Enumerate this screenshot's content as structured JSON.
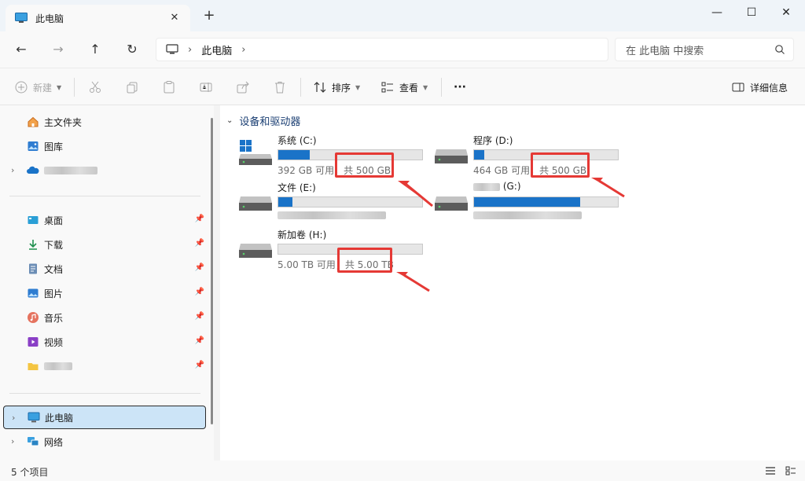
{
  "window": {
    "tab_title": "此电脑",
    "tab_close": "✕",
    "new_tab": "+",
    "minimize": "—",
    "maximize": "☐",
    "close": "✕"
  },
  "nav": {
    "back": "←",
    "forward": "→",
    "up": "↑",
    "refresh": "↻"
  },
  "address": {
    "separator": "›",
    "crumb": "此电脑"
  },
  "search": {
    "placeholder": "在 此电脑 中搜索"
  },
  "toolbar": {
    "new_label": "新建",
    "sort_label": "排序",
    "view_label": "查看",
    "more_label": "···",
    "details_label": "详细信息"
  },
  "sidebar": {
    "items": [
      {
        "label": "主文件夹",
        "icon": "home-icon"
      },
      {
        "label": "图库",
        "icon": "gallery-icon"
      },
      {
        "label": "",
        "icon": "onedrive-icon"
      },
      {
        "label": "桌面",
        "icon": "desktop-icon"
      },
      {
        "label": "下载",
        "icon": "download-icon"
      },
      {
        "label": "文档",
        "icon": "document-icon"
      },
      {
        "label": "图片",
        "icon": "pictures-icon"
      },
      {
        "label": "音乐",
        "icon": "music-icon"
      },
      {
        "label": "视频",
        "icon": "video-icon"
      },
      {
        "label": "",
        "icon": "folder-icon"
      },
      {
        "label": "此电脑",
        "icon": "computer-icon"
      },
      {
        "label": "网络",
        "icon": "network-icon"
      }
    ]
  },
  "content": {
    "group_title": "设备和驱动器",
    "drives": [
      {
        "name": "系统 (C:)",
        "info_free": "392 GB 可用，",
        "info_total": "共 500 GB",
        "used_fraction": 0.216
      },
      {
        "name": "程序 (D:)",
        "info_free": "464 GB 可用，",
        "info_total": "共 500 GB",
        "used_fraction": 0.072
      },
      {
        "name": "文件 (E:)",
        "info_free": "",
        "info_total": "",
        "used_fraction": 0.1
      },
      {
        "name": "(G:)",
        "info_free": "",
        "info_total": "",
        "used_fraction": 0.74
      },
      {
        "name": "新加卷 (H:)",
        "info_free": "5.00 TB 可用，",
        "info_total": "共 5.00 TB",
        "used_fraction": 0.0
      }
    ]
  },
  "status": {
    "item_count": "5 个项目"
  },
  "colors": {
    "accent": "#1a73c8",
    "highlight": "#e53935",
    "selection": "#cce4f7"
  }
}
